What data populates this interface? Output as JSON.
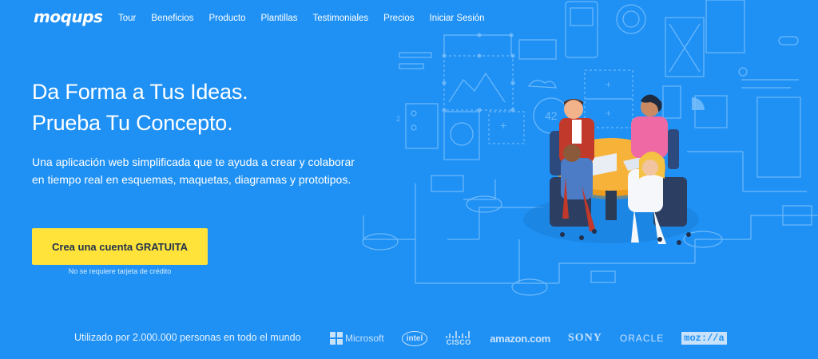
{
  "brand": {
    "logo_text": "moqups"
  },
  "nav": {
    "items": [
      {
        "label": "Tour"
      },
      {
        "label": "Beneficios"
      },
      {
        "label": "Producto"
      },
      {
        "label": "Plantillas"
      },
      {
        "label": "Testimoniales"
      },
      {
        "label": "Precios"
      },
      {
        "label": "Iniciar Sesión"
      }
    ]
  },
  "hero": {
    "title_line1": "Da Forma a Tus Ideas.",
    "title_line2": "Prueba Tu Concepto.",
    "description": "Una aplicación web simplificada que te ayuda a crear y colaborar en tiempo real en esquemas, maquetas, diagramas y prototipos.",
    "cta_label": "Crea una cuenta GRATUITA",
    "cta_note": "No se requiere tarjeta de crédito"
  },
  "social_proof": {
    "text": "Utilizado por 2.000.000 personas en todo el mundo",
    "brands": {
      "microsoft": "Microsoft",
      "intel": "intel",
      "cisco": "CISCO",
      "amazon": "amazon.com",
      "sony": "SONY",
      "oracle": "ORACLE",
      "mozilla": "moz://a"
    }
  },
  "illustration": {
    "card_number": "42",
    "step_number": "2"
  },
  "colors": {
    "background": "#1f91f5",
    "cta_background": "#ffe33b",
    "cta_text": "#21324a",
    "line_art": "#7fc0fb",
    "table": "#f5a623"
  }
}
